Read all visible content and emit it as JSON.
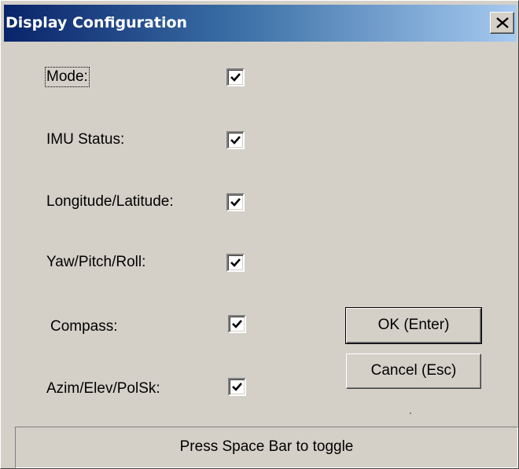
{
  "window": {
    "title": "Display Configuration",
    "title_gradient": [
      "#0a246a",
      "#a6caf0"
    ],
    "background": "#d4d0c8"
  },
  "options": [
    {
      "label": "Mode:",
      "checked": true,
      "focused": true
    },
    {
      "label": "IMU Status:",
      "checked": true,
      "focused": false
    },
    {
      "label": "Longitude/Latitude:",
      "checked": true,
      "focused": false
    },
    {
      "label": "Yaw/Pitch/Roll:",
      "checked": true,
      "focused": false
    },
    {
      "label": "Compass:",
      "checked": true,
      "focused": false
    },
    {
      "label": "Azim/Elev/PolSk:",
      "checked": true,
      "focused": false
    }
  ],
  "buttons": {
    "ok_label": "OK (Enter)",
    "cancel_label": "Cancel (Esc)"
  },
  "status": {
    "text": "Press Space Bar to toggle"
  },
  "icons": {
    "close": "close-icon",
    "check": "checkmark-icon"
  }
}
